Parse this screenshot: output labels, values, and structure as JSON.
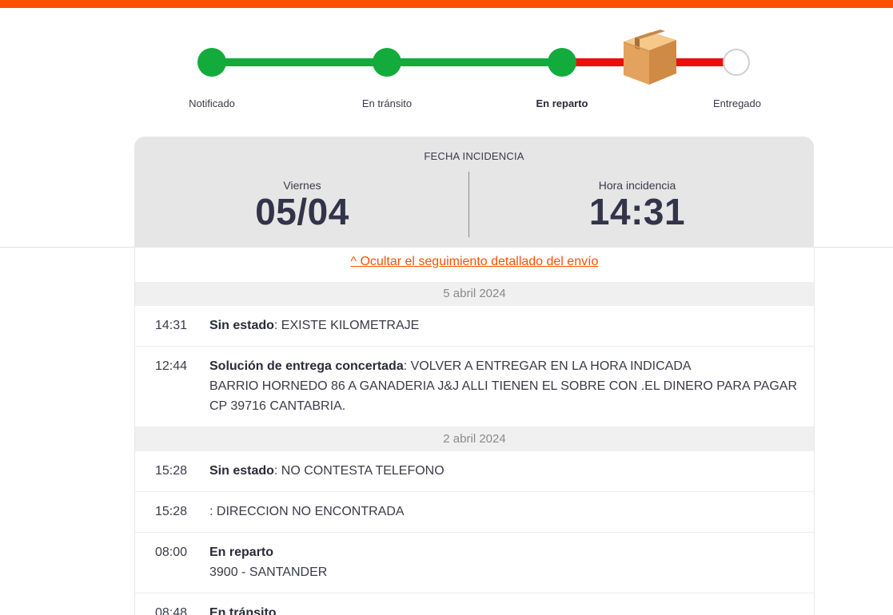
{
  "colors": {
    "brand": "#ff5000",
    "done": "#13ab3c",
    "problem": "#ee0c0c"
  },
  "tracker": {
    "steps": [
      {
        "label": "Notificado",
        "state": "done"
      },
      {
        "label": "En tránsito",
        "state": "done"
      },
      {
        "label": "En reparto",
        "state": "active"
      },
      {
        "label": "Entregado",
        "state": "pending"
      }
    ],
    "current_icon": "package-box-icon"
  },
  "incident": {
    "title": "FECHA INCIDENCIA",
    "day_label": "Viernes",
    "date": "05/04",
    "time_label": "Hora incidencia",
    "time": "14:31"
  },
  "history": {
    "toggle_link": "^ Ocultar el seguimiento detallado del envío",
    "groups": [
      {
        "date": "5 abril 2024",
        "events": [
          {
            "time": "14:31",
            "status": "Sin estado",
            "detail": ": EXISTE KILOMETRAJE"
          },
          {
            "time": "12:44",
            "status": "Solución de entrega concertada",
            "detail": ": VOLVER A ENTREGAR EN LA HORA INDICADA",
            "extra": [
              "BARRIO HORNEDO 86 A GANADERIA J&J ALLI TIENEN EL SOBRE CON .EL DINERO PARA PAGAR",
              "CP 39716 CANTABRIA."
            ]
          }
        ]
      },
      {
        "date": "2 abril 2024",
        "events": [
          {
            "time": "15:28",
            "status": "Sin estado",
            "detail": ": NO CONTESTA TELEFONO"
          },
          {
            "time": "15:28",
            "status": "",
            "detail": ": DIRECCION NO ENCONTRADA"
          },
          {
            "time": "08:00",
            "status": "En reparto",
            "detail": "",
            "extra": [
              "3900 - SANTANDER"
            ]
          },
          {
            "time": "08:48",
            "status": "En tránsito",
            "detail": ""
          }
        ]
      }
    ]
  }
}
